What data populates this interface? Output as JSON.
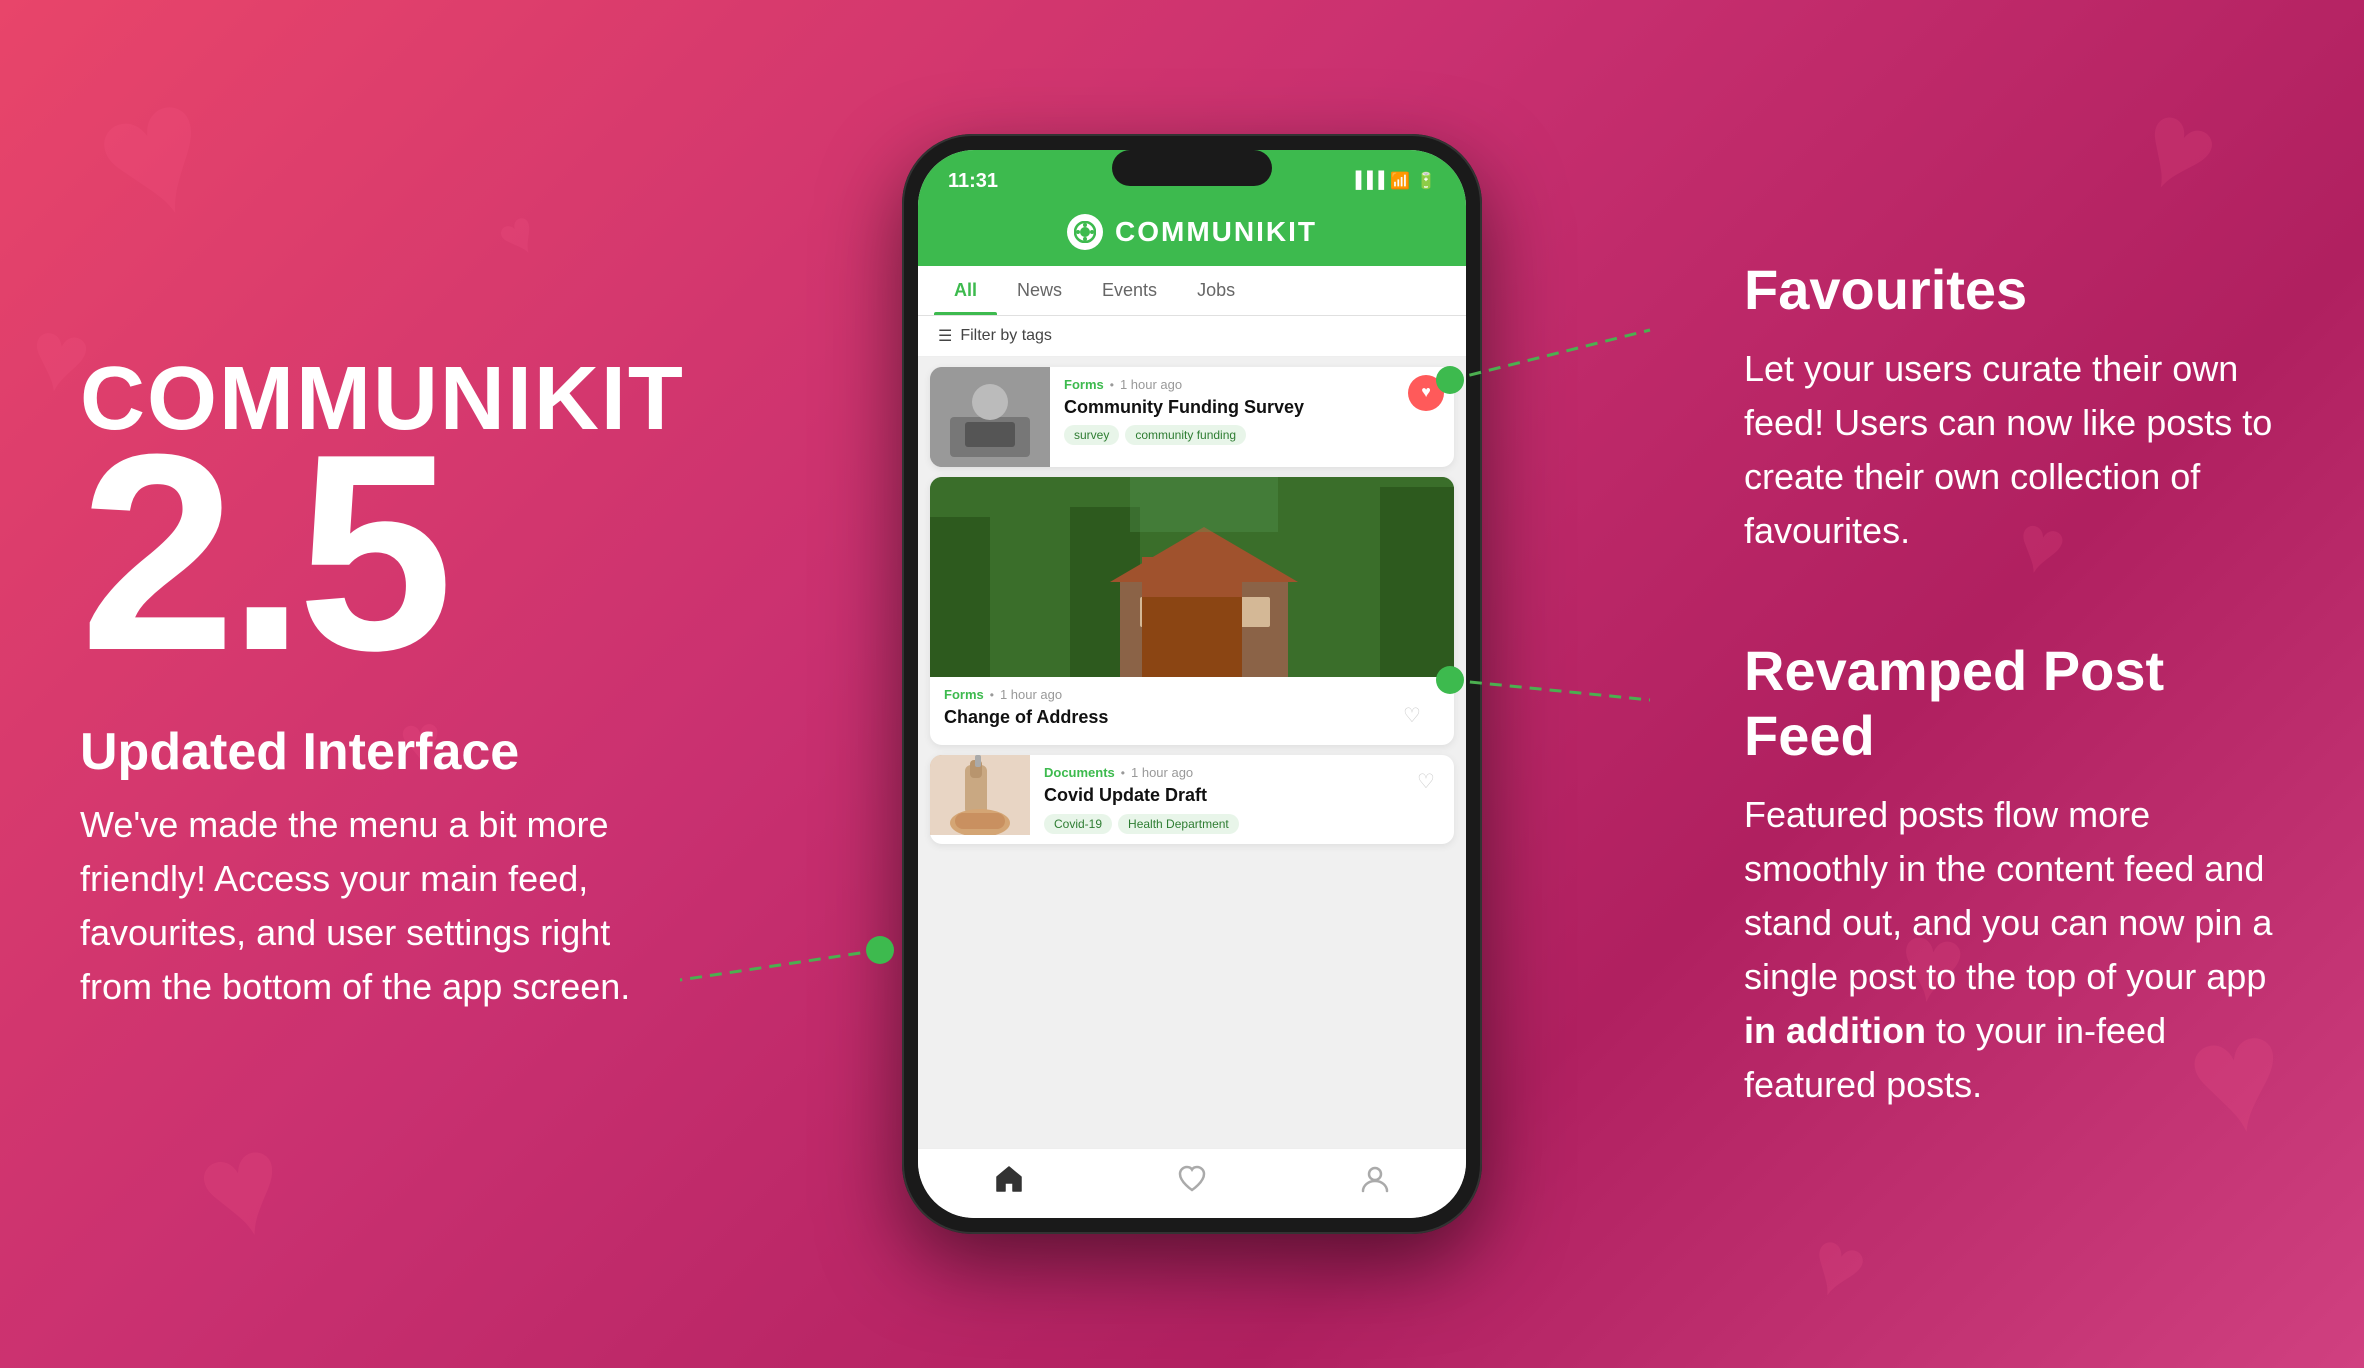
{
  "brand": {
    "name": "COMMUNIKIT",
    "version": "2.5"
  },
  "phone": {
    "status_time": "11:31",
    "app_name": "COMMUNIKIT",
    "tabs": [
      {
        "label": "All",
        "active": true
      },
      {
        "label": "News",
        "active": false
      },
      {
        "label": "Events",
        "active": false
      },
      {
        "label": "Jobs",
        "active": false
      }
    ],
    "filter_label": "Filter by tags",
    "posts": [
      {
        "category": "Forms",
        "time": "1 hour ago",
        "title": "Community Funding Survey",
        "tags": [
          "survey",
          "community funding"
        ],
        "has_image": true,
        "favorited": true
      },
      {
        "category": "Forms",
        "time": "1 hour ago",
        "title": "Change of Address",
        "tags": [],
        "has_image": true,
        "favorited": false
      },
      {
        "category": "Documents",
        "time": "1 hour ago",
        "title": "Covid Update Draft",
        "tags": [
          "Covid-19",
          "Health Department"
        ],
        "has_image": true,
        "favorited": false
      }
    ],
    "bottom_nav": [
      "home",
      "heart",
      "person"
    ]
  },
  "features": {
    "favourites": {
      "title": "Favourites",
      "text": "Let your users curate their own feed! Users can now like posts to create their own collection of favourites."
    },
    "revamped_post_feed": {
      "title": "Revamped Post Feed",
      "text_start": "Featured posts flow more smoothly in the content feed and stand out, and you can now pin a single post to the top of your app ",
      "text_bold": "in addition",
      "text_end": " to your in-feed featured posts."
    }
  },
  "updated_interface": {
    "title": "Updated Interface",
    "text": "We've made the menu a bit more friendly! Access your main feed, favourites, and user settings right from the bottom of the app screen."
  }
}
